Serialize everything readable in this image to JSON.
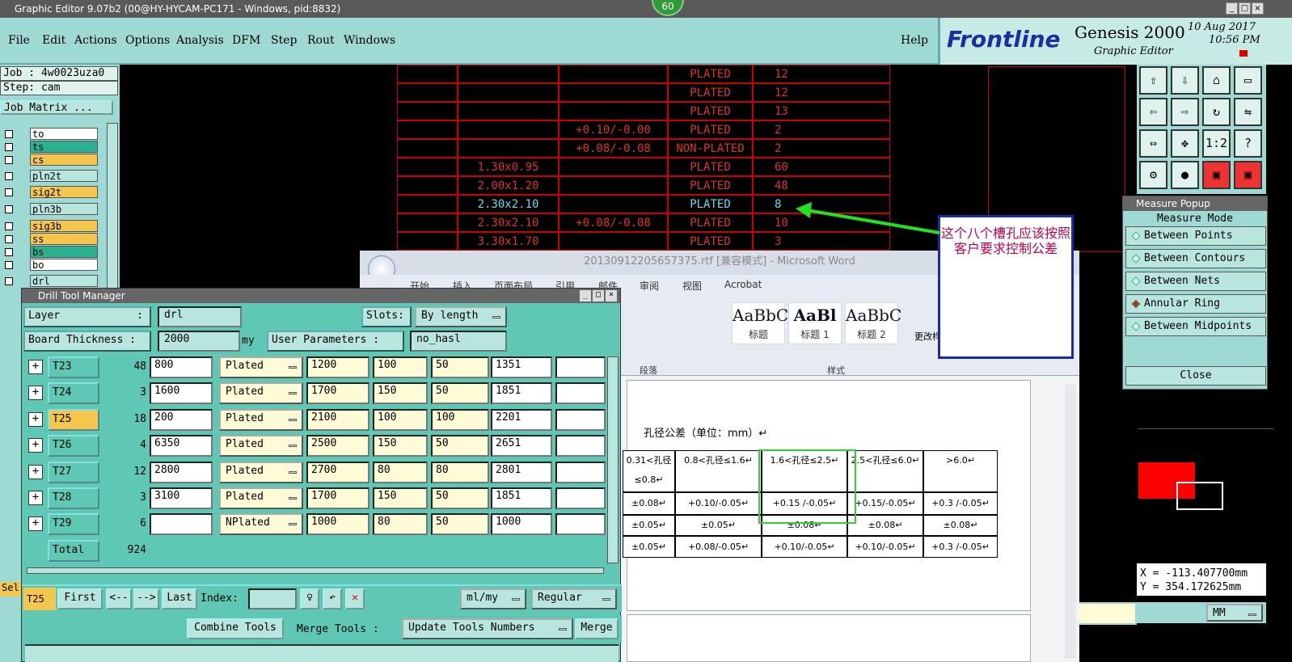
{
  "window": {
    "title": "Graphic Editor 9.07b2 (00@HY-HYCAM-PC171 - Windows, pid:8832)",
    "badge": "60"
  },
  "menu": [
    "File",
    "Edit",
    "Actions",
    "Options",
    "Analysis",
    "DFM",
    "Step",
    "Rout",
    "Windows"
  ],
  "help": "Help",
  "brand": {
    "logo": "Frontline",
    "product": "Genesis 2000",
    "sub": "Graphic Editor",
    "date": "10 Aug 2017",
    "time": "10:56 PM"
  },
  "job": {
    "job": "Job : 4w0023uza0",
    "step": "Step: cam",
    "matrix": "Job Matrix ..."
  },
  "layers": [
    {
      "name": "to",
      "color": "#ffffff"
    },
    {
      "name": "ts",
      "color": "#2bb090"
    },
    {
      "name": "cs",
      "color": "#f4c64e"
    },
    {
      "name": "pln2t",
      "color": "#b8e6df"
    },
    {
      "name": "sig2t",
      "color": "#f4c64e"
    },
    {
      "name": "pln3b",
      "color": "#b8e6df"
    },
    {
      "name": "sig3b",
      "color": "#f4c64e"
    },
    {
      "name": "ss",
      "color": "#f4c64e"
    },
    {
      "name": "bs",
      "color": "#2bb090"
    },
    {
      "name": "bo",
      "color": "#ffffff"
    },
    {
      "name": "drl",
      "color": "#b8e6df"
    }
  ],
  "canvas_table": [
    [
      "",
      "",
      "",
      "PLATED",
      "12"
    ],
    [
      "",
      "",
      "",
      "PLATED",
      "12"
    ],
    [
      "",
      "",
      "",
      "PLATED",
      "13"
    ],
    [
      "",
      "",
      "+0.10/-0.00",
      "PLATED",
      "2"
    ],
    [
      "",
      "",
      "+0.08/-0.08",
      "NON-PLATED",
      "2"
    ],
    [
      "",
      "1.30x0.95",
      "",
      "PLATED",
      "60"
    ],
    [
      "",
      "2.00x1.20",
      "",
      "PLATED",
      "48"
    ],
    [
      "",
      "2.30x2.10",
      "",
      "PLATED",
      "8"
    ],
    [
      "",
      "2.30x2.10",
      "+0.08/-0.08",
      "PLATED",
      "10"
    ],
    [
      "",
      "3.30x1.70",
      "",
      "PLATED",
      "3"
    ]
  ],
  "callout": "这个八个槽孔应该按照客户要求控制公差",
  "measure": {
    "title": "Measure Popup",
    "mode": "Measure Mode",
    "items": [
      "Between Points",
      "Between Contours",
      "Between Nets",
      "Annular Ring",
      "Between Midpoints"
    ],
    "close": "Close"
  },
  "coords": {
    "x": "X = -113.407700mm",
    "y": "Y = 354.172625mm"
  },
  "unit": "MM",
  "word": {
    "title": "20130912205657375.rtf [兼容模式] - Microsoft Word",
    "tabs": [
      "开始",
      "插入",
      "页面布局",
      "引用",
      "邮件",
      "审阅",
      "视图",
      "Acrobat"
    ],
    "styles": [
      {
        "sample": "AaBbC",
        "name": "标题"
      },
      {
        "sample": "AaBl",
        "name": "标题 1"
      },
      {
        "sample": "AaBbC",
        "name": "标题 2"
      }
    ],
    "change_style": "更改样式",
    "group_para": "段落",
    "group_style": "样式",
    "heading": "孔径公差（单位：mm）↵",
    "table": [
      [
        "0.31<孔径≤0.8↵",
        "0.8<孔径≤1.6↵",
        "1.6<孔径≤2.5↵",
        "2.5<孔径≤6.0↵",
        ">6.0↵"
      ],
      [
        "±0.08↵",
        "+0.10/-0.05↵",
        "+0.15 /-0.05↵",
        "+0.15/-0.05↵",
        "+0.3 /-0.05↵"
      ],
      [
        "±0.05↵",
        "±0.05↵",
        "±0.08↵",
        "±0.08↵",
        "±0.08↵"
      ],
      [
        "±0.05↵",
        "+0.08/-0.05↵",
        "+0.10/-0.05↵",
        "+0.10/-0.05↵",
        "+0.3 /-0.05↵"
      ]
    ]
  },
  "dtm": {
    "title": "Drill Tool Manager",
    "layer_label": "Layer",
    "layer_value": "drl",
    "slots_label": "Slots:",
    "slots_value": "By length",
    "thick_label": "Board Thickness :",
    "thick_value": "2000",
    "thick_unit": "my",
    "user_label": "User Parameters :",
    "user_value": "no_hasl",
    "rows": [
      {
        "tool": "T23",
        "count": "48",
        "size": "800",
        "type": "Plated",
        "a": "1200",
        "b": "100",
        "c": "50",
        "d": "1351"
      },
      {
        "tool": "T24",
        "count": "3",
        "size": "1600",
        "type": "Plated",
        "a": "1700",
        "b": "150",
        "c": "50",
        "d": "1851"
      },
      {
        "tool": "T25",
        "count": "18",
        "size": "200",
        "type": "Plated",
        "a": "2100",
        "b": "100",
        "c": "100",
        "d": "2201"
      },
      {
        "tool": "T26",
        "count": "4",
        "size": "6350",
        "type": "Plated",
        "a": "2500",
        "b": "150",
        "c": "50",
        "d": "2651"
      },
      {
        "tool": "T27",
        "count": "12",
        "size": "2800",
        "type": "Plated",
        "a": "2700",
        "b": "80",
        "c": "80",
        "d": "2801"
      },
      {
        "tool": "T28",
        "count": "3",
        "size": "3100",
        "type": "Plated",
        "a": "1700",
        "b": "150",
        "c": "50",
        "d": "1851"
      },
      {
        "tool": "T29",
        "count": "6",
        "size": "",
        "type": "NPlated",
        "a": "1000",
        "b": "80",
        "c": "50",
        "d": "1000"
      }
    ],
    "total_label": "Total",
    "total_value": "924",
    "nav": {
      "current": "T25",
      "first": "First",
      "prev": "<--",
      "next": "-->",
      "last": "Last",
      "index": "Index:",
      "units": "ml/my",
      "mode": "Regular"
    },
    "actions": {
      "combine": "Combine Tools",
      "merge_label": "Merge Tools :",
      "update": "Update Tools Numbers",
      "merge": "Merge"
    }
  }
}
